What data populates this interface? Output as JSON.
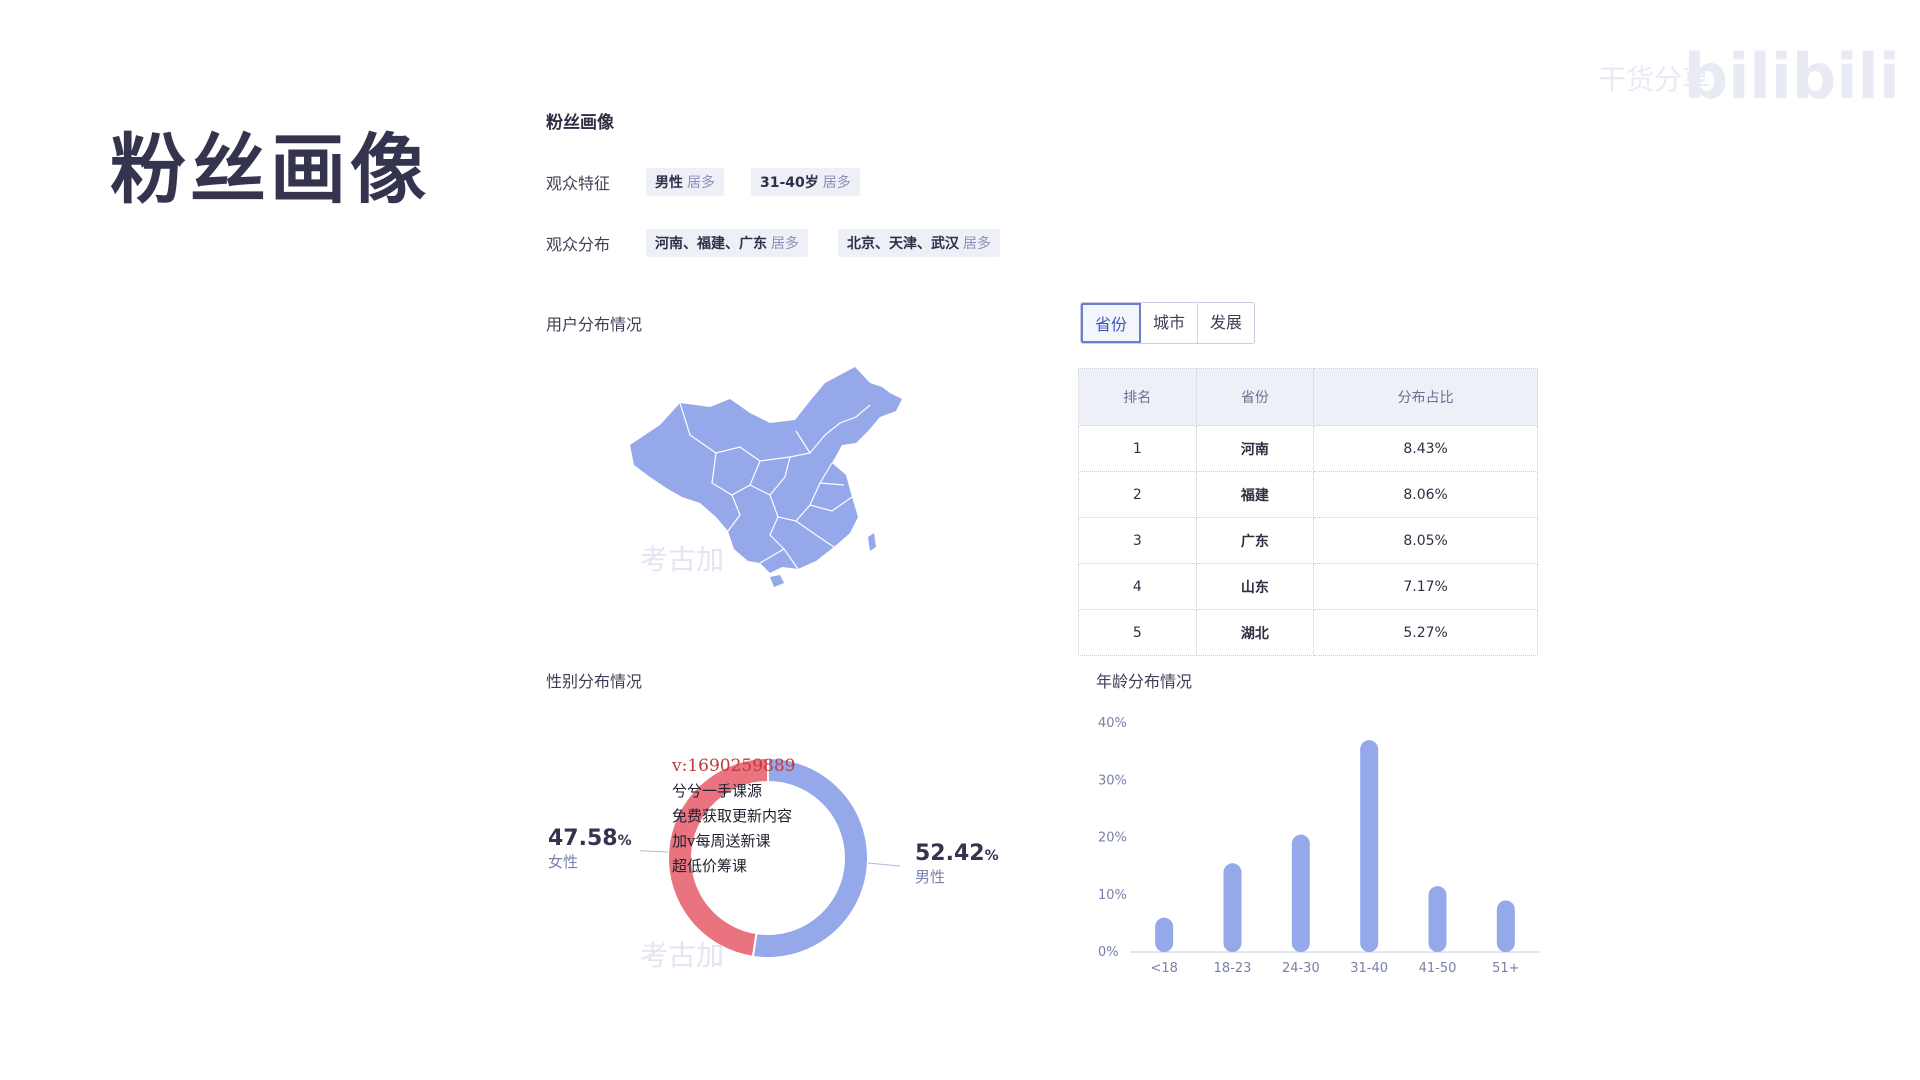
{
  "page_title": "粉丝画像",
  "brand": {
    "text": "bilibili",
    "sub": "干货分享"
  },
  "section_title": "粉丝画像",
  "features": {
    "label": "观众特征",
    "chips": [
      {
        "value": "男性",
        "suffix": "居多"
      },
      {
        "value": "31-40岁",
        "suffix": "居多"
      }
    ]
  },
  "distribution": {
    "label": "观众分布",
    "chips": [
      {
        "value": "河南、福建、广东",
        "suffix": "居多"
      },
      {
        "value": "北京、天津、武汉",
        "suffix": "居多"
      }
    ]
  },
  "user_dist": {
    "title": "用户分布情况"
  },
  "tabs": [
    "省份",
    "城市",
    "发展"
  ],
  "rank_table": {
    "headers": [
      "排名",
      "省份",
      "分布占比"
    ],
    "rows": [
      [
        "1",
        "河南",
        "8.43%"
      ],
      [
        "2",
        "福建",
        "8.06%"
      ],
      [
        "3",
        "广东",
        "8.05%"
      ],
      [
        "4",
        "山东",
        "7.17%"
      ],
      [
        "5",
        "湖北",
        "5.27%"
      ]
    ]
  },
  "gender": {
    "title": "性别分布情况",
    "female_pct": "47.58",
    "female_label": "女性",
    "male_pct": "52.42",
    "male_label": "男性",
    "percent_sign": "%"
  },
  "age": {
    "title": "年龄分布情况"
  },
  "watermark": {
    "text": "考古加"
  },
  "overlay_text": {
    "line1": "v:1690259889",
    "line2": "兮兮一手课源",
    "line3": "免费获取更新内容",
    "line4": "加v每周送新课",
    "line5": "超低价筹课"
  },
  "colors": {
    "female": "#e9737f",
    "male": "#95a8ea",
    "map": "#95a8ea",
    "bar": "#95a8ea"
  },
  "chart_data": [
    {
      "type": "pie",
      "title": "性别分布情况",
      "categories": [
        "女性",
        "男性"
      ],
      "values": [
        47.58,
        52.42
      ]
    },
    {
      "type": "bar",
      "title": "年龄分布情况",
      "categories": [
        "<18",
        "18-23",
        "24-30",
        "31-40",
        "41-50",
        "51+"
      ],
      "values": [
        6,
        15.5,
        20.5,
        37,
        11.5,
        9
      ],
      "yticks": [
        "0%",
        "10%",
        "20%",
        "30%",
        "40%"
      ],
      "ylim": [
        0,
        40
      ]
    }
  ]
}
